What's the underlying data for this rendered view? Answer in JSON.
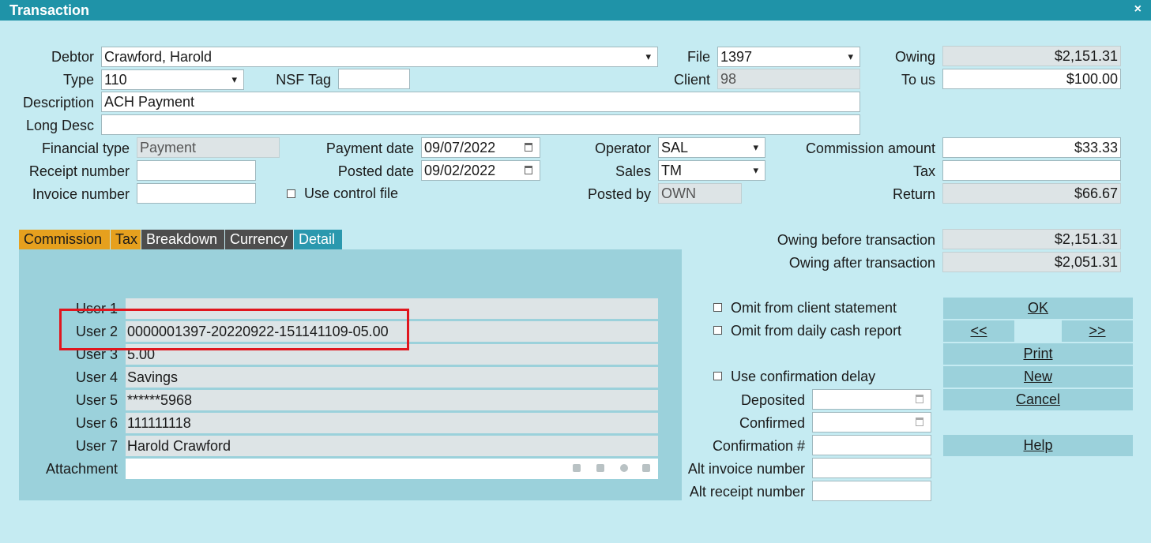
{
  "window": {
    "title": "Transaction",
    "close_glyph": "×"
  },
  "header": {
    "debtor_label": "Debtor",
    "debtor_value": "Crawford, Harold",
    "file_label": "File",
    "file_value": "1397",
    "owing_label": "Owing",
    "owing_value": "$2,151.31",
    "type_label": "Type",
    "type_value": "110",
    "nsf_label": "NSF Tag",
    "nsf_value": "",
    "client_label": "Client",
    "client_value": "98",
    "tous_label": "To us",
    "tous_value": "$100.00",
    "description_label": "Description",
    "description_value": "ACH Payment",
    "longdesc_label": "Long Desc",
    "longdesc_value": "",
    "fintype_label": "Financial type",
    "fintype_value": "Payment",
    "paydate_label": "Payment date",
    "paydate_value": "09/07/2022",
    "operator_label": "Operator",
    "operator_value": "SAL",
    "commission_label": "Commission amount",
    "commission_value": "$33.33",
    "receipt_label": "Receipt number",
    "receipt_value": "",
    "posteddate_label": "Posted date",
    "posteddate_value": "09/02/2022",
    "sales_label": "Sales",
    "sales_value": "TM",
    "tax_label": "Tax",
    "tax_value": "",
    "invoice_label": "Invoice number",
    "invoice_value": "",
    "usecontrol_label": "Use control file",
    "postedby_label": "Posted by",
    "postedby_value": "OWN",
    "return_label": "Return",
    "return_value": "$66.67"
  },
  "tabs": [
    {
      "label": "Commission"
    },
    {
      "label": "Tax"
    },
    {
      "label": "Breakdown"
    },
    {
      "label": "Currency"
    },
    {
      "label": "Detail"
    }
  ],
  "owing_summary": {
    "before_label": "Owing before transaction",
    "before_value": "$2,151.31",
    "after_label": "Owing after transaction",
    "after_value": "$2,051.31"
  },
  "detail": {
    "user1_label": "User 1",
    "user1_value": "",
    "user2_label": "User 2",
    "user2_value": "0000001397-20220922-151141109-05.00",
    "user3_label": "User 3",
    "user3_value": "5.00",
    "user4_label": "User 4",
    "user4_value": "Savings",
    "user5_label": "User 5",
    "user5_value": "******5968",
    "user6_label": "User 6",
    "user6_value": "111111118",
    "user7_label": "User 7",
    "user7_value": "Harold Crawford",
    "attachment_label": "Attachment",
    "attachment_value": ""
  },
  "options": {
    "omit_client_label": "Omit from client statement",
    "omit_cash_label": "Omit from daily cash report",
    "use_confirm_label": "Use confirmation delay",
    "deposited_label": "Deposited",
    "deposited_value": "",
    "confirmed_label": "Confirmed",
    "confirmed_value": "",
    "confirmation_no_label": "Confirmation #",
    "confirmation_no_value": "",
    "alt_invoice_label": "Alt invoice number",
    "alt_invoice_value": "",
    "alt_receipt_label": "Alt receipt number",
    "alt_receipt_value": ""
  },
  "buttons": {
    "ok": "OK",
    "prev": "<<",
    "next": ">>",
    "print": "Print",
    "new": "New",
    "cancel": "Cancel",
    "help": "Help"
  }
}
